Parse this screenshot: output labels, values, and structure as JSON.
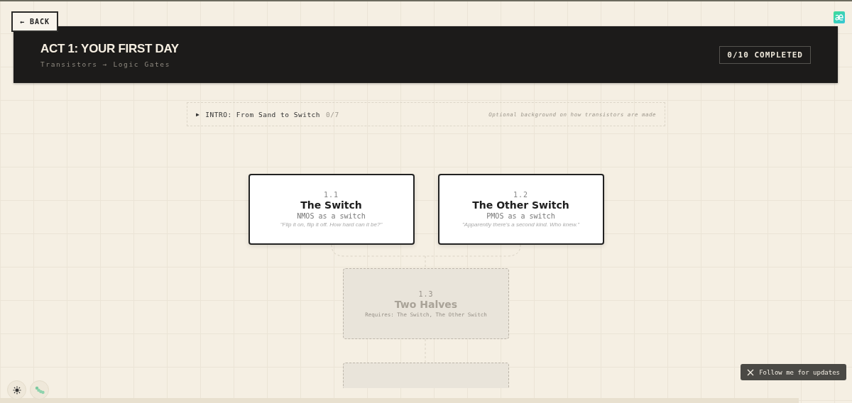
{
  "back_button": {
    "label": "← BACK"
  },
  "header": {
    "title": "ACT 1: YOUR FIRST DAY",
    "subtitle": "Transistors → Logic Gates",
    "progress": "0/10 COMPLETED"
  },
  "intro": {
    "icon": "▶",
    "label": "INTRO: From Sand to Switch",
    "count": "0/7",
    "note": "Optional background on how transistors are made",
    "expanded": false
  },
  "levels": [
    {
      "number": "1.1",
      "title": "The Switch",
      "subtitle": "NMOS as a switch",
      "quote": "\"Flip it on, flip it off. How hard can it be?\"",
      "locked": false
    },
    {
      "number": "1.2",
      "title": "The Other Switch",
      "subtitle": "PMOS as a switch",
      "quote": "\"Apparently there's a second kind. Who knew.\"",
      "locked": false
    },
    {
      "number": "1.3",
      "title": "Two Halves",
      "requires": "Requires: The Switch, The Other Switch",
      "locked": true
    },
    {
      "locked": true
    }
  ],
  "follow_button": {
    "label": "Follow me for updates"
  }
}
